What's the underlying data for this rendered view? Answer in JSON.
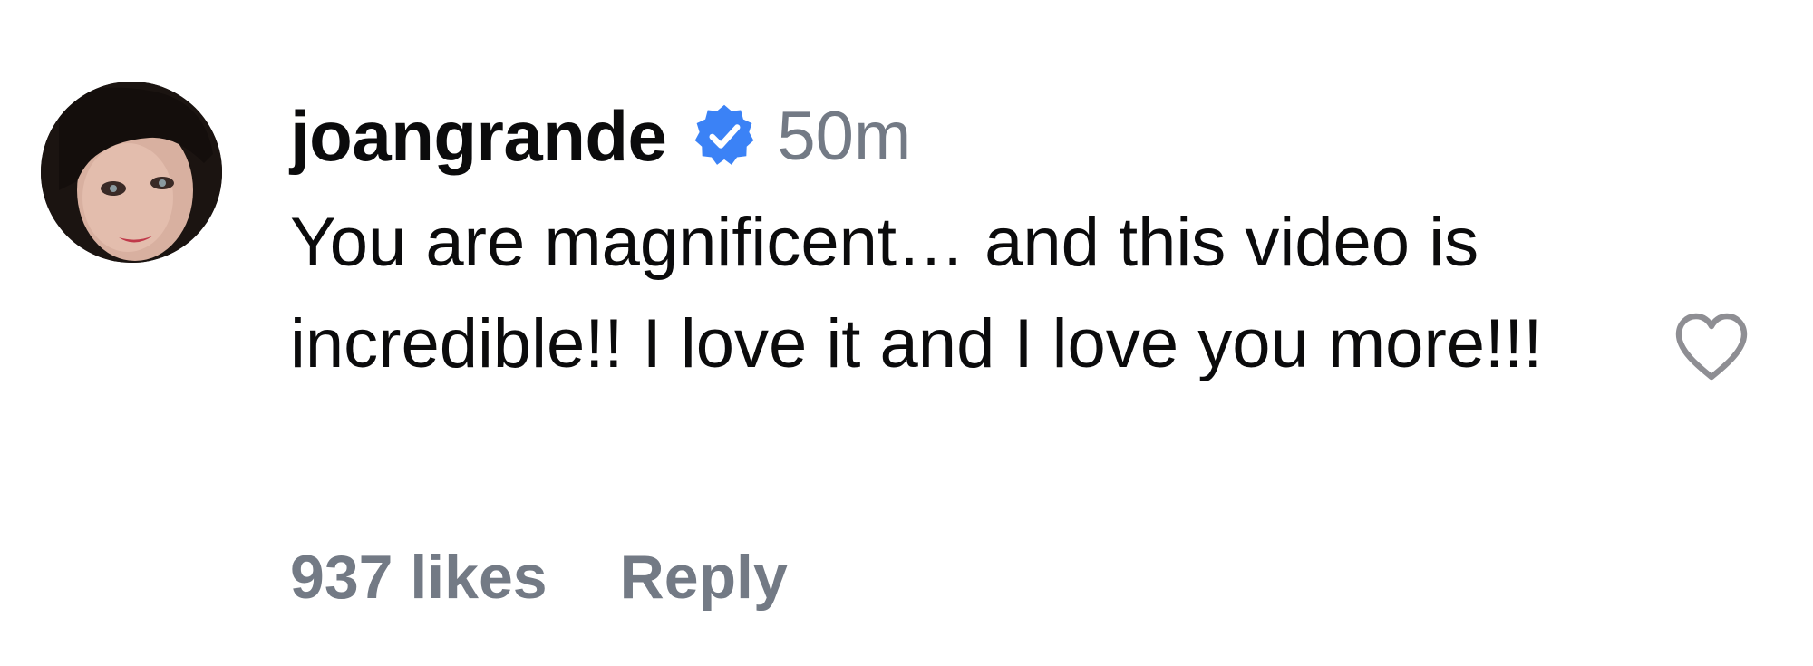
{
  "comment": {
    "username": "joangrande",
    "verified": true,
    "verified_icon": "verified-badge-icon",
    "verified_color": "#3b82f6",
    "time": "50m",
    "text": "You are magnificent… and this video is incredible!! I love it and I love you more!!!",
    "likes_label": "937 likes",
    "reply_label": "Reply",
    "like_icon": "heart-outline-icon",
    "avatar_icon": "user-avatar"
  },
  "colors": {
    "primary_text": "#0b0b0c",
    "secondary_text": "#737a85",
    "icon_gray": "#8e8e93",
    "background": "#ffffff"
  }
}
